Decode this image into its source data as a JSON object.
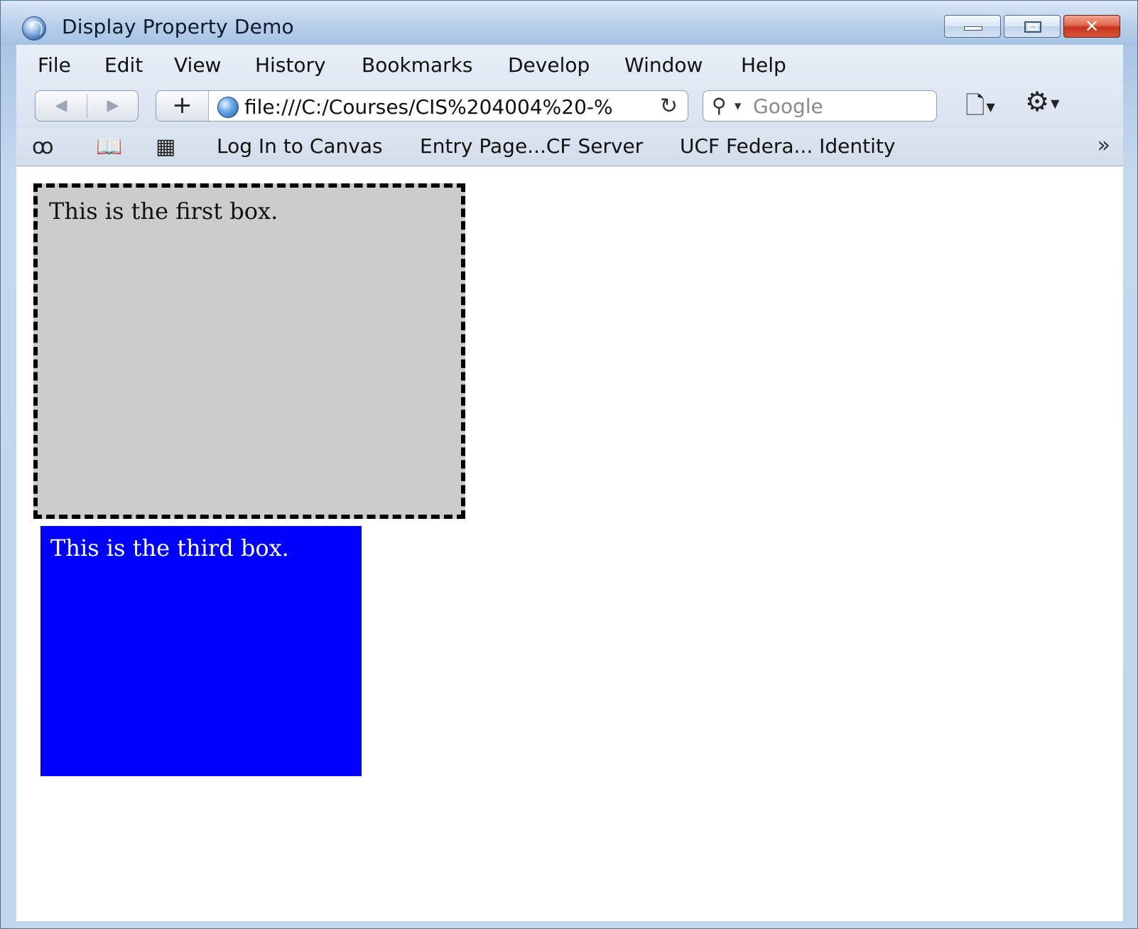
{
  "window": {
    "title": "Display Property Demo"
  },
  "menu": [
    "File",
    "Edit",
    "View",
    "History",
    "Bookmarks",
    "Develop",
    "Window",
    "Help"
  ],
  "toolbar": {
    "address": "file:///C:/Courses/CIS%204004%20-%",
    "search_placeholder": "Google",
    "add_label": "+"
  },
  "bookmarks": [
    "Log In to Canvas",
    "Entry Page...CF Server",
    "UCF Federa... Identity"
  ],
  "content": {
    "first_box": "This is the first box.",
    "third_box": "This is the third box."
  },
  "colors": {
    "first_box_bg": "#cccccc",
    "first_box_border": "#000000",
    "third_box_bg": "#0000ff",
    "third_box_text": "#ffffff"
  },
  "icons": [
    "app-icon",
    "minimize-icon",
    "maximize-icon",
    "close-icon",
    "back-arrow-icon",
    "forward-arrow-icon",
    "globe-icon",
    "reload-icon",
    "search-icon",
    "page-menu-icon",
    "settings-gear-icon",
    "reader-glasses-icon",
    "book-icon",
    "top-sites-grid-icon",
    "chevron-more-icon"
  ]
}
